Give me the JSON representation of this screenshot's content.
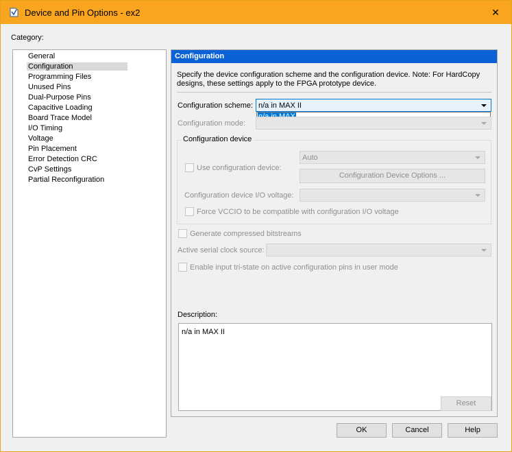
{
  "window": {
    "title": "Device and Pin Options - ex2",
    "close_glyph": "✕"
  },
  "category": {
    "label": "Category:",
    "items": [
      {
        "label": "General"
      },
      {
        "label": "Configuration",
        "selected": true
      },
      {
        "label": "Programming Files"
      },
      {
        "label": "Unused Pins"
      },
      {
        "label": "Dual-Purpose Pins"
      },
      {
        "label": "Capacitive Loading"
      },
      {
        "label": "Board Trace Model"
      },
      {
        "label": "I/O Timing"
      },
      {
        "label": "Voltage"
      },
      {
        "label": "Pin Placement"
      },
      {
        "label": "Error Detection CRC"
      },
      {
        "label": "CvP Settings"
      },
      {
        "label": "Partial Reconfiguration"
      }
    ]
  },
  "panel": {
    "header": "Configuration",
    "intro": "Specify the device configuration scheme and the configuration device. Note: For HardCopy designs, these settings apply to the FPGA prototype device.",
    "config_scheme_label": "Configuration scheme:",
    "config_scheme_value": "n/a in MAX II",
    "config_scheme_option": "n/a in MAX II",
    "config_mode_label": "Configuration mode:",
    "config_device_group": "Configuration device",
    "use_config_device_label": "Use configuration device:",
    "config_device_value": "Auto",
    "config_device_options_button": "Configuration Device Options ...",
    "io_voltage_label": "Configuration device I/O voltage:",
    "force_vccio_label": "Force VCCIO to be compatible with configuration I/O voltage",
    "compressed_label": "Generate compressed bitstreams",
    "serial_clock_label": "Active serial clock source:",
    "tristate_label": "Enable input tri-state on active configuration pins in user mode",
    "description_label": "Description:",
    "description_text": "n/a in MAX II",
    "reset_button": "Reset"
  },
  "footer": {
    "ok": "OK",
    "cancel": "Cancel",
    "help": "Help"
  },
  "colors": {
    "titlebar": "#f9a51f",
    "panel_header": "#0a62d6",
    "selection": "#0078d7"
  }
}
